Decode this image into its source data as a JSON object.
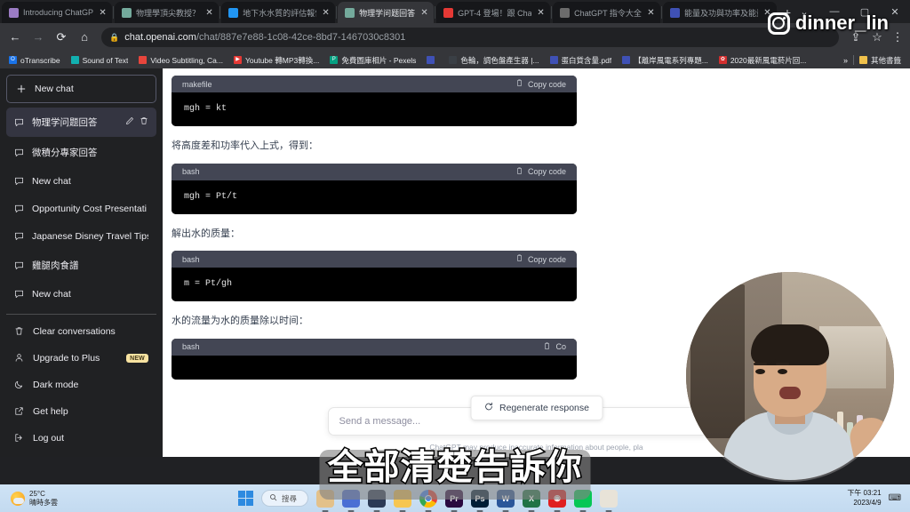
{
  "browser": {
    "tabs": [
      {
        "title": "Introducing ChatGP",
        "favicon": "chatgpt-icon",
        "color": "#9b7cc4",
        "active": false
      },
      {
        "title": "物理學頂尖教授？",
        "favicon": "chatgpt-icon",
        "color": "#74aa9c",
        "active": false
      },
      {
        "title": "地下水水質的評估報告",
        "favicon": "info-icon",
        "color": "#2196f3",
        "active": false
      },
      {
        "title": "物理学问题回答",
        "favicon": "chatgpt-icon",
        "color": "#74aa9c",
        "active": true
      },
      {
        "title": "GPT-4 登場！跟 Cha",
        "favicon": "checkbox-icon",
        "color": "#e53935",
        "active": false
      },
      {
        "title": "ChatGPT 指令大全",
        "favicon": "doc-icon",
        "color": "#6c6c6c",
        "active": false
      },
      {
        "title": "能量及功與功率及能量",
        "favicon": "globe-icon",
        "color": "#3f51b5",
        "active": false
      }
    ],
    "new_tab_label": "+",
    "window_controls": [
      "⌄",
      "—",
      "▢",
      "✕"
    ],
    "nav": {
      "back_icon": "arrow-left-icon",
      "forward_icon": "arrow-right-icon",
      "reload_icon": "reload-icon",
      "home_icon": "home-icon",
      "lock_icon": "lock-icon",
      "url_host": "chat.openai.com",
      "url_path": "/chat/887e7e88-1c08-42ce-8bd7-1467030c8301",
      "share_icon": "share-icon",
      "bookmark_icon": "star-icon",
      "menu_icon": "kebab-menu-icon"
    },
    "bookmarks": [
      {
        "label": "oTranscribe",
        "color": "#1a73e8",
        "glyph": "O"
      },
      {
        "label": "Sound of Text",
        "color": "#12b0b0",
        "glyph": ""
      },
      {
        "label": "Video Subtitling, Ca...",
        "color": "#e8453c",
        "glyph": ""
      },
      {
        "label": "Youtube 轉MP3轉換...",
        "color": "#e53935",
        "glyph": "▶"
      },
      {
        "label": "免費圖庫相片 - Pexels",
        "color": "#05a081",
        "glyph": "P"
      },
      {
        "label": "",
        "color": "#3f51b5",
        "glyph": ""
      },
      {
        "label": "色輪，調色盤產生器 |...",
        "color": "#3a3f45",
        "glyph": ""
      },
      {
        "label": "蛋白質含量.pdf",
        "color": "#3f51b5",
        "glyph": ""
      },
      {
        "label": "【離岸風電系列專題...",
        "color": "#3f51b5",
        "glyph": ""
      },
      {
        "label": "2020最新風電菸片回...",
        "color": "#d32f2f",
        "glyph": "✿"
      }
    ],
    "bookmarks_overflow": "»",
    "other_bookmarks": {
      "label": "其他書籤",
      "icon": "folder-icon",
      "color": "#f0c14b"
    }
  },
  "sidebar": {
    "new_chat": {
      "label": "New chat",
      "icon": "plus-icon"
    },
    "conversations": [
      {
        "label": "物理学问题回答",
        "selected": true,
        "icon": "chat-bubble-icon",
        "edit_icon": "pencil-icon",
        "delete_icon": "trash-icon"
      },
      {
        "label": "微積分專家回答",
        "selected": false,
        "icon": "chat-bubble-icon"
      },
      {
        "label": "New chat",
        "selected": false,
        "icon": "chat-bubble-icon"
      },
      {
        "label": "Opportunity Cost Presentati",
        "selected": false,
        "icon": "chat-bubble-icon"
      },
      {
        "label": "Japanese Disney Travel Tips",
        "selected": false,
        "icon": "chat-bubble-icon"
      },
      {
        "label": "雞腿肉食譜",
        "selected": false,
        "icon": "chat-bubble-icon"
      },
      {
        "label": "New chat",
        "selected": false,
        "icon": "chat-bubble-icon"
      }
    ],
    "menu": [
      {
        "label": "Clear conversations",
        "icon": "trash-icon"
      },
      {
        "label": "Upgrade to Plus",
        "icon": "person-icon",
        "badge": "NEW"
      },
      {
        "label": "Dark mode",
        "icon": "moon-icon"
      },
      {
        "label": "Get help",
        "icon": "external-link-icon"
      },
      {
        "label": "Log out",
        "icon": "logout-icon"
      }
    ]
  },
  "main": {
    "blocks": [
      {
        "type": "code",
        "lang": "makefile",
        "copy": "Copy code",
        "code": "mgh = kt"
      },
      {
        "type": "text",
        "text": "将高度差和功率代入上式，得到："
      },
      {
        "type": "code",
        "lang": "bash",
        "copy": "Copy code",
        "code": "mgh = Pt/t"
      },
      {
        "type": "text",
        "text": "解出水的质量："
      },
      {
        "type": "code",
        "lang": "bash",
        "copy": "Copy code",
        "code": "m = Pt/gh"
      },
      {
        "type": "text",
        "text": "水的流量为水的质量除以时间："
      },
      {
        "type": "code",
        "lang": "bash",
        "copy": "Co",
        "code": ""
      }
    ],
    "regenerate": {
      "label": "Regenerate response",
      "icon": "refresh-icon"
    },
    "composer": {
      "placeholder": "Send a message...",
      "send_icon": "send-icon",
      "disclaimer": "ChatGPT may produce inaccurate information about people, pla"
    }
  },
  "overlay": {
    "ig_handle": "dinner_lin",
    "ig_icon": "instagram-icon",
    "subtitle": "全部清楚告訴你"
  },
  "taskbar": {
    "weather": {
      "temp": "25°C",
      "condition": "晴時多雲",
      "icon": "sun-cloud-icon"
    },
    "start_icon": "windows-logo-icon",
    "search_placeholder": "搜尋",
    "search_icon": "search-icon",
    "apps": [
      {
        "name": "notes-app",
        "color": "#e3c18a",
        "glyph": "",
        "running": true
      },
      {
        "name": "teams-app",
        "color": "#4a6fd4",
        "glyph": "",
        "running": true
      },
      {
        "name": "book-app",
        "color": "#2b3a55",
        "glyph": "",
        "running": true
      },
      {
        "name": "explorer-app",
        "color": "#f6c651",
        "glyph": "",
        "running": true
      },
      {
        "name": "chrome-app",
        "color": "#f1f1f1",
        "glyph": "",
        "running": true
      },
      {
        "name": "premiere-app",
        "color": "#2a0a40",
        "glyph": "Pr",
        "running": true
      },
      {
        "name": "photoshop-app",
        "color": "#001e36",
        "glyph": "Ps",
        "running": true
      },
      {
        "name": "word-app",
        "color": "#2b579a",
        "glyph": "W",
        "running": true
      },
      {
        "name": "excel-app",
        "color": "#217346",
        "glyph": "X",
        "running": true
      },
      {
        "name": "record-app",
        "color": "#e02020",
        "glyph": "◉",
        "running": true
      },
      {
        "name": "line-app",
        "color": "#06c755",
        "glyph": "",
        "running": true
      },
      {
        "name": "speaker-app",
        "color": "#e8e3d8",
        "glyph": "",
        "running": true
      }
    ],
    "clock": {
      "time": "下午 03:21",
      "date": "2023/4/9"
    },
    "tray_icon": "tray-icon"
  }
}
